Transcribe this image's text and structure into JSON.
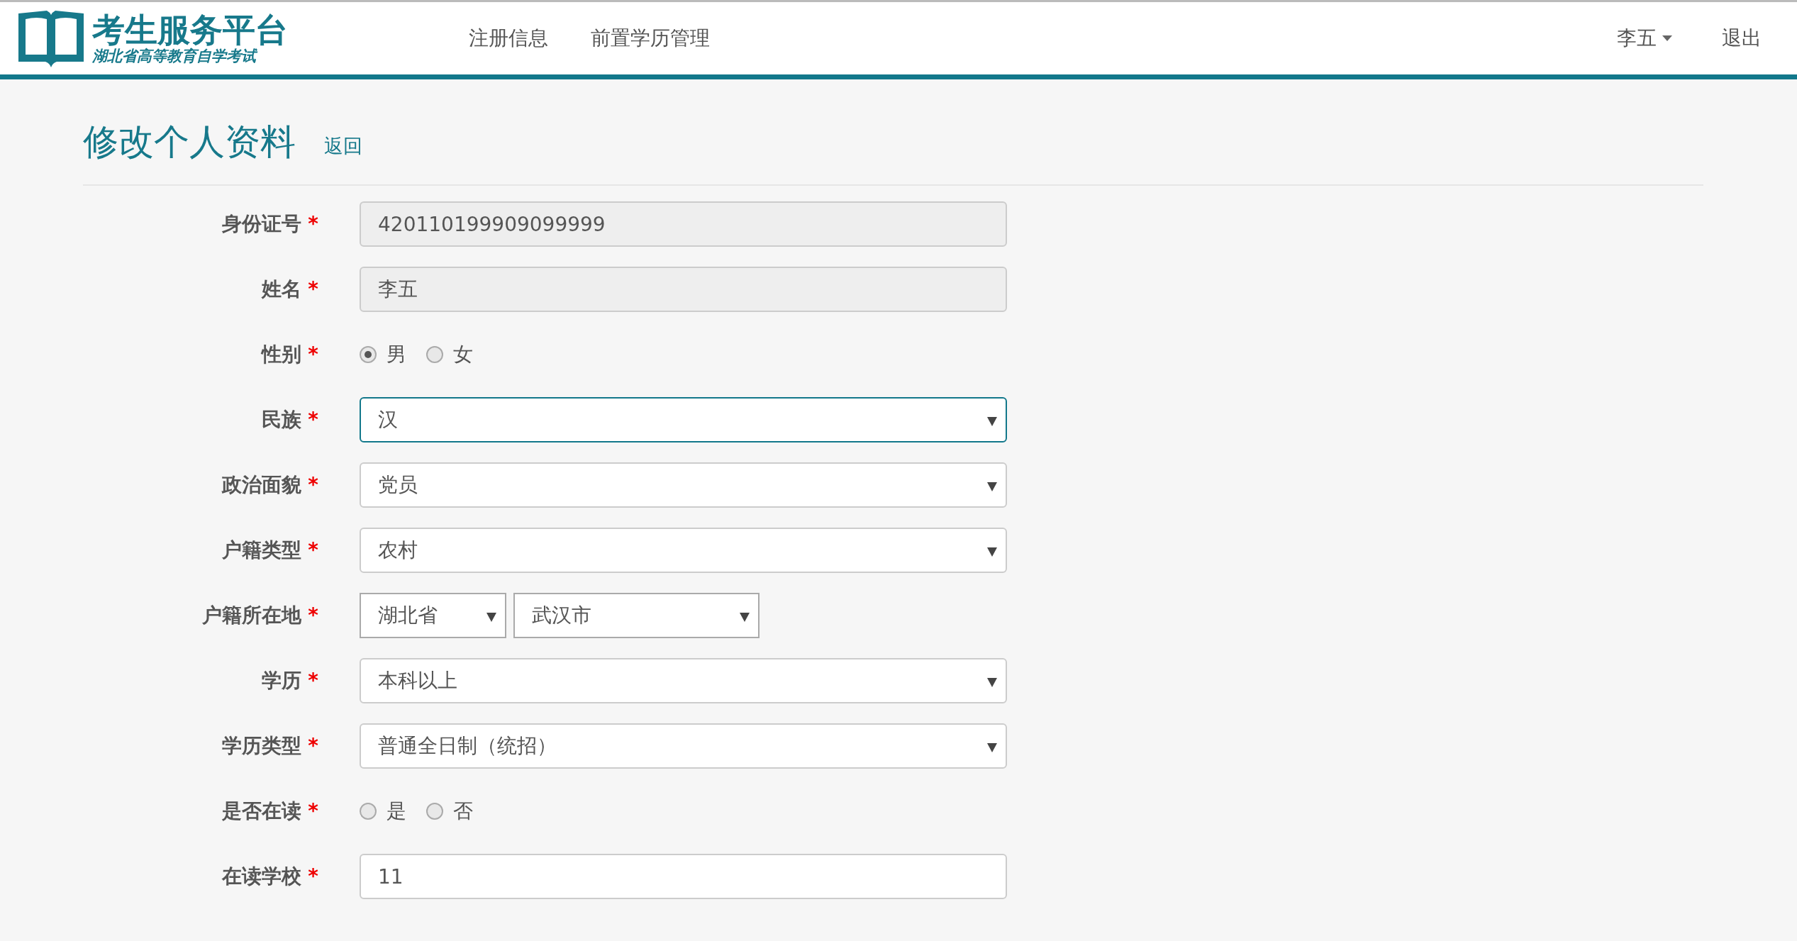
{
  "header": {
    "logo_title": "考生服务平台",
    "logo_subtitle": "湖北省高等教育自学考试",
    "nav": [
      {
        "label": "注册信息"
      },
      {
        "label": "前置学历管理"
      }
    ],
    "user_menu": {
      "label": "李五"
    },
    "logout": "退出"
  },
  "page": {
    "title": "修改个人资料",
    "back_link": "返回"
  },
  "form": {
    "rows": [
      {
        "kind": "text",
        "label": "身份证号",
        "required_mark": "*",
        "value": "420110199909099999",
        "disabled": true
      },
      {
        "kind": "text",
        "label": "姓名",
        "required_mark": "*",
        "value": "李五",
        "disabled": true
      },
      {
        "kind": "radio",
        "label": "性别",
        "required_mark": "*",
        "options": [
          {
            "label": "男",
            "selected": true
          },
          {
            "label": "女",
            "selected": false
          }
        ]
      },
      {
        "kind": "select",
        "label": "民族",
        "required_mark": "*",
        "selects": [
          {
            "value": "汉",
            "focused": true
          }
        ]
      },
      {
        "kind": "select",
        "label": "政治面貌",
        "required_mark": "*",
        "selects": [
          {
            "value": "党员",
            "focused": false
          }
        ]
      },
      {
        "kind": "select",
        "label": "户籍类型",
        "required_mark": "*",
        "selects": [
          {
            "value": "农村",
            "focused": false
          }
        ]
      },
      {
        "kind": "select",
        "label": "户籍所在地",
        "required_mark": "*",
        "selects": [
          {
            "value": "湖北省",
            "focused": false
          },
          {
            "value": "武汉市",
            "focused": false
          }
        ]
      },
      {
        "kind": "select",
        "label": "学历",
        "required_mark": "*",
        "selects": [
          {
            "value": "本科以上",
            "focused": false
          }
        ]
      },
      {
        "kind": "select",
        "label": "学历类型",
        "required_mark": "*",
        "selects": [
          {
            "value": "普通全日制（统招）",
            "focused": false
          }
        ]
      },
      {
        "kind": "radio",
        "label": "是否在读",
        "required_mark": "*",
        "options": [
          {
            "label": "是",
            "selected": false
          },
          {
            "label": "否",
            "selected": false
          }
        ]
      },
      {
        "kind": "text",
        "label": "在读学校",
        "required_mark": "*",
        "value": "11",
        "disabled": false
      }
    ]
  }
}
